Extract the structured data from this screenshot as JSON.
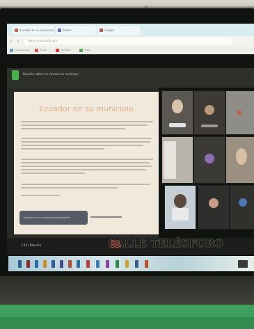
{
  "browser": {
    "tabs": [
      {
        "label": "Ecuador en su municipio"
      },
      {
        "label": "Teams"
      },
      {
        "label": "Google"
      }
    ],
    "new_tab_icon": "plus-icon",
    "url": "teams.microsoft.com",
    "bookmarks": [
      "Aplicaciones",
      "Gmail",
      "YouTube",
      "Maps"
    ]
  },
  "meeting": {
    "logo_icon": "teams-icon",
    "title": "Reunión sobre: La Vicedes en municipal",
    "slide_title": "Ecuador en su municipio",
    "presenter_label": "Ecuador en su municipio presentación",
    "time": "1:32 | Reunión"
  },
  "watermark": "CALLE TELÉSFORO",
  "colors": {
    "desk": "#3fa05d",
    "slide_title": "#e0b28c",
    "taskbar": "#a8c9d6"
  }
}
